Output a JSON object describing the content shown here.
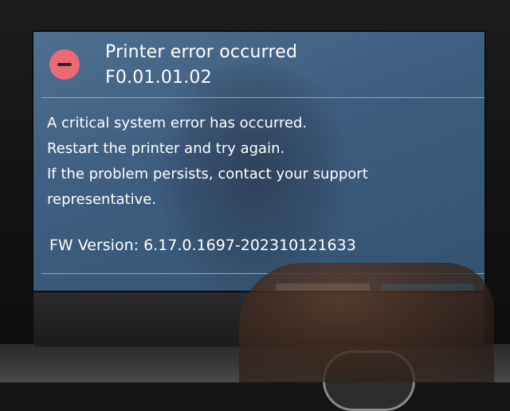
{
  "dialog": {
    "title": "Printer error occurred",
    "error_code": "F0.01.01.02",
    "icon": "error-circle-minus-icon",
    "message_lines": [
      "A critical system error has occurred.",
      "Restart the printer and try again.",
      "If the problem persists, contact your support",
      "representative."
    ],
    "firmware_version": "FW Version: 6.17.0.1697-202310121633"
  },
  "colors": {
    "screen_background": "#3d5d80",
    "error_icon": "#ee6a72",
    "text": "#ffffff",
    "primary_button": "#2aa7e6",
    "secondary_button": "#c9d4de"
  }
}
